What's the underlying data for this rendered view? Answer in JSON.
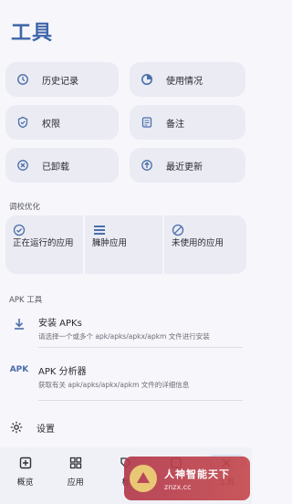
{
  "header": {
    "title": "工具"
  },
  "quick": [
    {
      "label": "历史记录",
      "icon": "history-icon"
    },
    {
      "label": "使用情况",
      "icon": "pie-chart-icon"
    },
    {
      "label": "权限",
      "icon": "shield-icon"
    },
    {
      "label": "备注",
      "icon": "note-icon"
    },
    {
      "label": "已卸载",
      "icon": "uninstalled-icon"
    },
    {
      "label": "最近更新",
      "icon": "update-icon"
    }
  ],
  "tuning": {
    "title": "调校优化",
    "items": [
      {
        "label": "正在运行的应用",
        "icon": "check-circle-icon"
      },
      {
        "label": "臃肿应用",
        "icon": "list-icon"
      },
      {
        "label": "未使用的应用",
        "icon": "block-icon"
      }
    ]
  },
  "apk": {
    "title": "APK 工具",
    "items": [
      {
        "title": "安装 APKs",
        "desc": "请选择一个或多个 apk/apks/apkx/apkm 文件进行安装",
        "icon": "download-icon"
      },
      {
        "title": "APK 分析器",
        "desc": "获取有关 apk/apks/apkx/apkm 文件的详细信息",
        "icon_text": "APK"
      }
    ]
  },
  "settings": {
    "label": "设置"
  },
  "nav": [
    {
      "label": "概览",
      "icon": "plus-square-icon"
    },
    {
      "label": "应用",
      "icon": "grid-icon"
    },
    {
      "label": "标",
      "icon": "tag-icon"
    },
    {
      "label": "",
      "icon": "box-icon"
    },
    {
      "label": "工具",
      "icon": "tools-icon",
      "active": true
    }
  ],
  "watermark": {
    "line1": "人神智能天下",
    "line2": "znzx.cc"
  },
  "colors": {
    "accent": "#4a6eaa",
    "card": "#eaebf3",
    "title": "#3f66a8"
  }
}
